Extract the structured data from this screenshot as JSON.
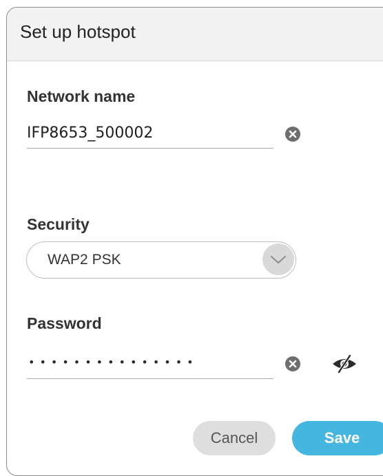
{
  "dialog": {
    "title": "Set up hotspot"
  },
  "network": {
    "label": "Network name",
    "value": "IFP8653_500002"
  },
  "security": {
    "label": "Security",
    "selected": "WAP2 PSK"
  },
  "password": {
    "label": "Password",
    "masked_value": "•••••••••••••••"
  },
  "buttons": {
    "cancel_label": "Cancel",
    "save_label": "Save"
  },
  "icons": {
    "clear": "clear-circle-x",
    "dropdown": "chevron-down",
    "visibility": "eye-slash"
  },
  "colors": {
    "accent": "#45b6e0",
    "header_bg": "#f2f2f2",
    "icon_gray": "#6e6e6e"
  }
}
